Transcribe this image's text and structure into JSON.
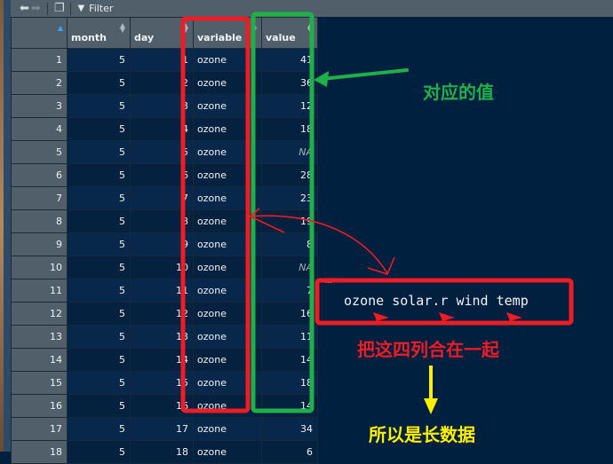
{
  "toolbar": {
    "back_icon": "arrow-left-icon",
    "forward_icon": "arrow-right-icon",
    "popout_icon": "popout-window-icon",
    "filter_label": "Filter",
    "filter_icon": "funnel-icon"
  },
  "table": {
    "columns": [
      "month",
      "day",
      "variable",
      "value"
    ],
    "rows": [
      {
        "n": "1",
        "month": "5",
        "day": "1",
        "variable": "ozone",
        "value": "41"
      },
      {
        "n": "2",
        "month": "5",
        "day": "2",
        "variable": "ozone",
        "value": "36"
      },
      {
        "n": "3",
        "month": "5",
        "day": "3",
        "variable": "ozone",
        "value": "12"
      },
      {
        "n": "4",
        "month": "5",
        "day": "4",
        "variable": "ozone",
        "value": "18"
      },
      {
        "n": "5",
        "month": "5",
        "day": "5",
        "variable": "ozone",
        "value": "NA"
      },
      {
        "n": "6",
        "month": "5",
        "day": "6",
        "variable": "ozone",
        "value": "28"
      },
      {
        "n": "7",
        "month": "5",
        "day": "7",
        "variable": "ozone",
        "value": "23"
      },
      {
        "n": "8",
        "month": "5",
        "day": "8",
        "variable": "ozone",
        "value": "19"
      },
      {
        "n": "9",
        "month": "5",
        "day": "9",
        "variable": "ozone",
        "value": "8"
      },
      {
        "n": "10",
        "month": "5",
        "day": "10",
        "variable": "ozone",
        "value": "NA"
      },
      {
        "n": "11",
        "month": "5",
        "day": "11",
        "variable": "ozone",
        "value": "7"
      },
      {
        "n": "12",
        "month": "5",
        "day": "12",
        "variable": "ozone",
        "value": "16"
      },
      {
        "n": "13",
        "month": "5",
        "day": "13",
        "variable": "ozone",
        "value": "11"
      },
      {
        "n": "14",
        "month": "5",
        "day": "14",
        "variable": "ozone",
        "value": "14"
      },
      {
        "n": "15",
        "month": "5",
        "day": "15",
        "variable": "ozone",
        "value": "18"
      },
      {
        "n": "16",
        "month": "5",
        "day": "16",
        "variable": "ozone",
        "value": "14"
      },
      {
        "n": "17",
        "month": "5",
        "day": "17",
        "variable": "ozone",
        "value": "34"
      },
      {
        "n": "18",
        "month": "5",
        "day": "18",
        "variable": "ozone",
        "value": "6"
      }
    ]
  },
  "code": {
    "columns_line": " ozone solar.r wind temp"
  },
  "annotations": {
    "value_label": "对应的值",
    "combine_label": "把这四列合在一起",
    "long_data_label": "所以是长数据",
    "green": "#1fb04a",
    "red": "#ee1c24",
    "yellow": "#ffef00"
  }
}
